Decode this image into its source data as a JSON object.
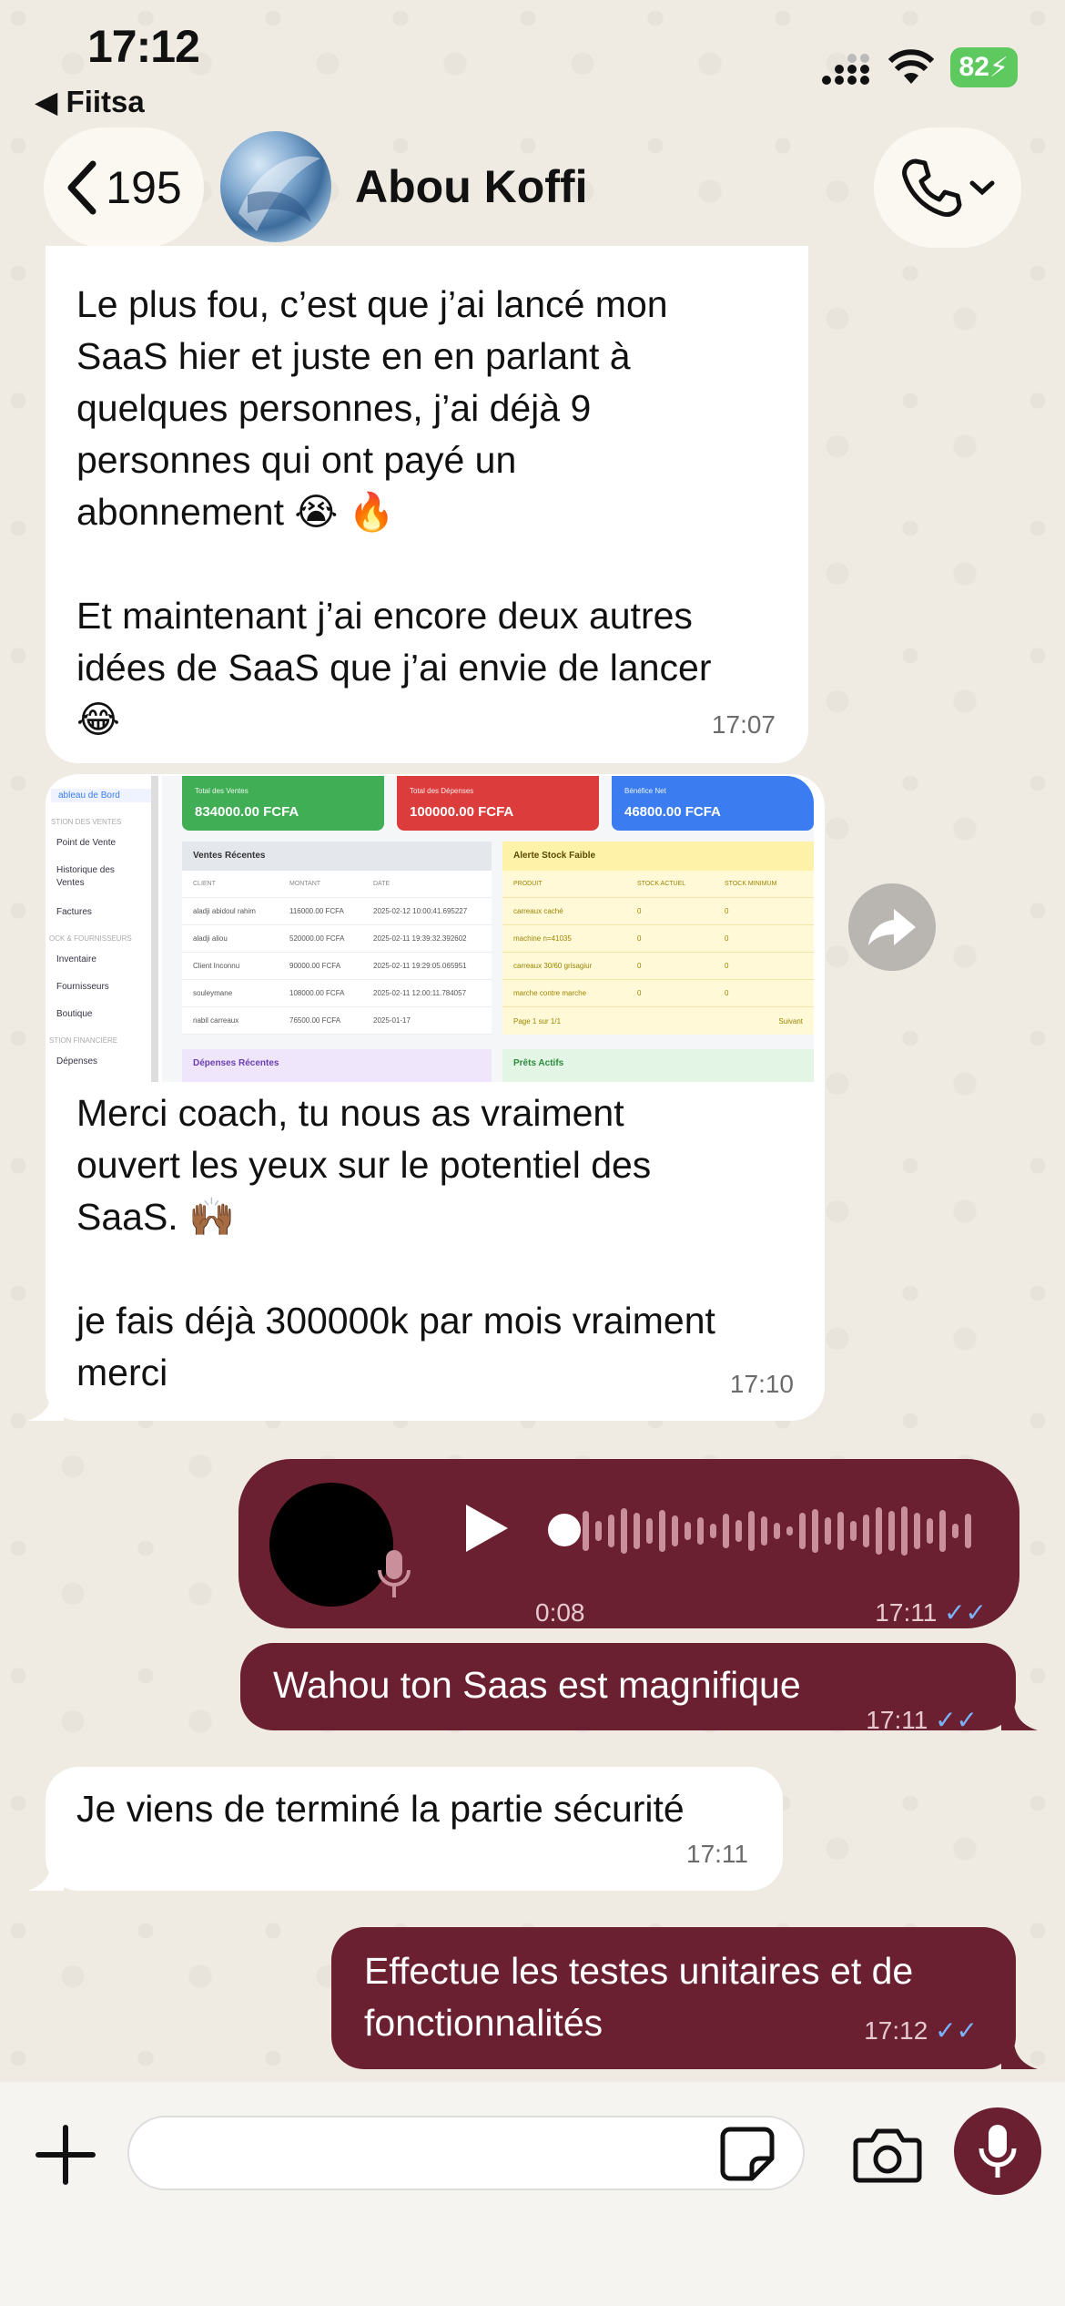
{
  "status": {
    "time": "17:12",
    "back_app": "Fiitsa",
    "battery": "82"
  },
  "header": {
    "back_count": "195",
    "contact_name": "Abou Koffi"
  },
  "messages": [
    {
      "text": "Le plus fou, c’est que j’ai lancé mon\nSaaS hier et juste en en parlant à\nquelques personnes, j’ai déjà 9\npersonnes qui ont payé un\nabonnement 😭 🔥\n\nEt maintenant j’ai encore deux autres\nidées de SaaS que j’ai envie de lancer\n😂",
      "time": "17:07"
    },
    {
      "text": "Merci coach, tu nous as vraiment\nouvert les yeux sur le potentiel des\nSaaS. 🙌🏾\n\nje fais déjà 300000k par mois vraiment\nmerci",
      "time": "17:10"
    },
    {
      "voice_duration": "0:08",
      "time": "17:11"
    },
    {
      "text": "Wahou ton Saas est magnifique",
      "time": "17:11"
    },
    {
      "text": "Je viens de terminé la partie sécurité",
      "time": "17:11"
    },
    {
      "text": "Effectue les testes unitaires et de\nfonctionnalités",
      "time": "17:12"
    }
  ],
  "dashboard": {
    "sidebar": [
      "ableau de Bord",
      "STION DES VENTES",
      "Point de Vente",
      "Historique des",
      "Ventes",
      "Factures",
      "OCK & FOURNISSEURS",
      "Inventaire",
      "Fournisseurs",
      "Boutique",
      "STION FINANCIÈRE",
      "Dépenses"
    ],
    "cards": [
      {
        "title": "Total des Ventes",
        "value": "834000.00 FCFA",
        "color": "#3fae55"
      },
      {
        "title": "Total des Dépenses",
        "value": "100000.00 FCFA",
        "color": "#dc3c3c"
      },
      {
        "title": "Bénéfice Net",
        "value": "46800.00 FCFA",
        "color": "#3b7df0"
      }
    ],
    "sales": {
      "title": "Ventes Récentes",
      "headers": [
        "CLIENT",
        "MONTANT",
        "DATE"
      ],
      "rows": [
        [
          "aladji abidoul rahim",
          "116000.00 FCFA",
          "2025-02-12 10:00:41.695227"
        ],
        [
          "aladji aliou",
          "520000.00 FCFA",
          "2025-02-11 19:39:32.392602"
        ],
        [
          "Client Inconnu",
          "90000.00 FCFA",
          "2025-02-11 19:29:05.065951"
        ],
        [
          "souleymane",
          "108000.00 FCFA",
          "2025-02-11 12:00:11.784057"
        ],
        [
          "nabil carreaux",
          "76500.00 FCFA",
          "2025-01-17"
        ]
      ]
    },
    "stock": {
      "title": "Alerte Stock Faible",
      "headers": [
        "PRODUIT",
        "STOCK ACTUEL",
        "STOCK MINIMUM"
      ],
      "rows": [
        [
          "carreaux caché",
          "0",
          "0"
        ],
        [
          "machine n=41035",
          "0",
          "0"
        ],
        [
          "carreaux 30/60 grisagiur",
          "0",
          "0"
        ],
        [
          "marche contre marche",
          "0",
          "0"
        ]
      ],
      "pager": "Page 1 sur 1/1",
      "next": "Suivant"
    },
    "expenses_title": "Dépenses Récentes",
    "loans_title": "Prêts Actifs"
  },
  "composer": {
    "placeholder": ""
  }
}
